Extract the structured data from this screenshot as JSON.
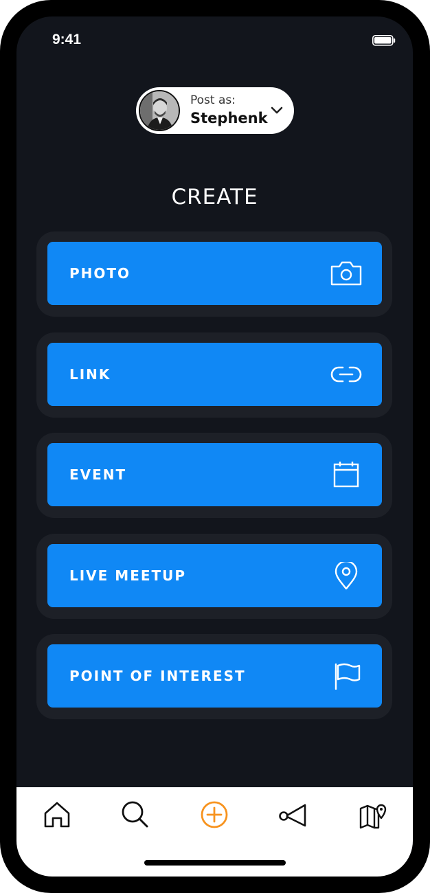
{
  "status_bar": {
    "time": "9:41"
  },
  "post_as": {
    "label": "Post as:",
    "name": "Stephenk"
  },
  "page": {
    "title": "CREATE"
  },
  "options": [
    {
      "label": "PHOTO",
      "icon": "camera-icon"
    },
    {
      "label": "LINK",
      "icon": "link-icon"
    },
    {
      "label": "EVENT",
      "icon": "calendar-icon"
    },
    {
      "label": "LIVE MEETUP",
      "icon": "location-pin-icon"
    },
    {
      "label": "POINT OF INTEREST",
      "icon": "flag-icon"
    }
  ],
  "tabbar": {
    "items": [
      {
        "icon": "home-icon",
        "active": false
      },
      {
        "icon": "search-icon",
        "active": false
      },
      {
        "icon": "add-circle-icon",
        "active": true
      },
      {
        "icon": "megaphone-icon",
        "active": false
      },
      {
        "icon": "map-pin-icon",
        "active": false
      }
    ]
  },
  "colors": {
    "background": "#12151c",
    "card": "#1d2027",
    "button": "#1088f5",
    "active_tab": "#f7931e",
    "inactive_tab": "#111111"
  }
}
